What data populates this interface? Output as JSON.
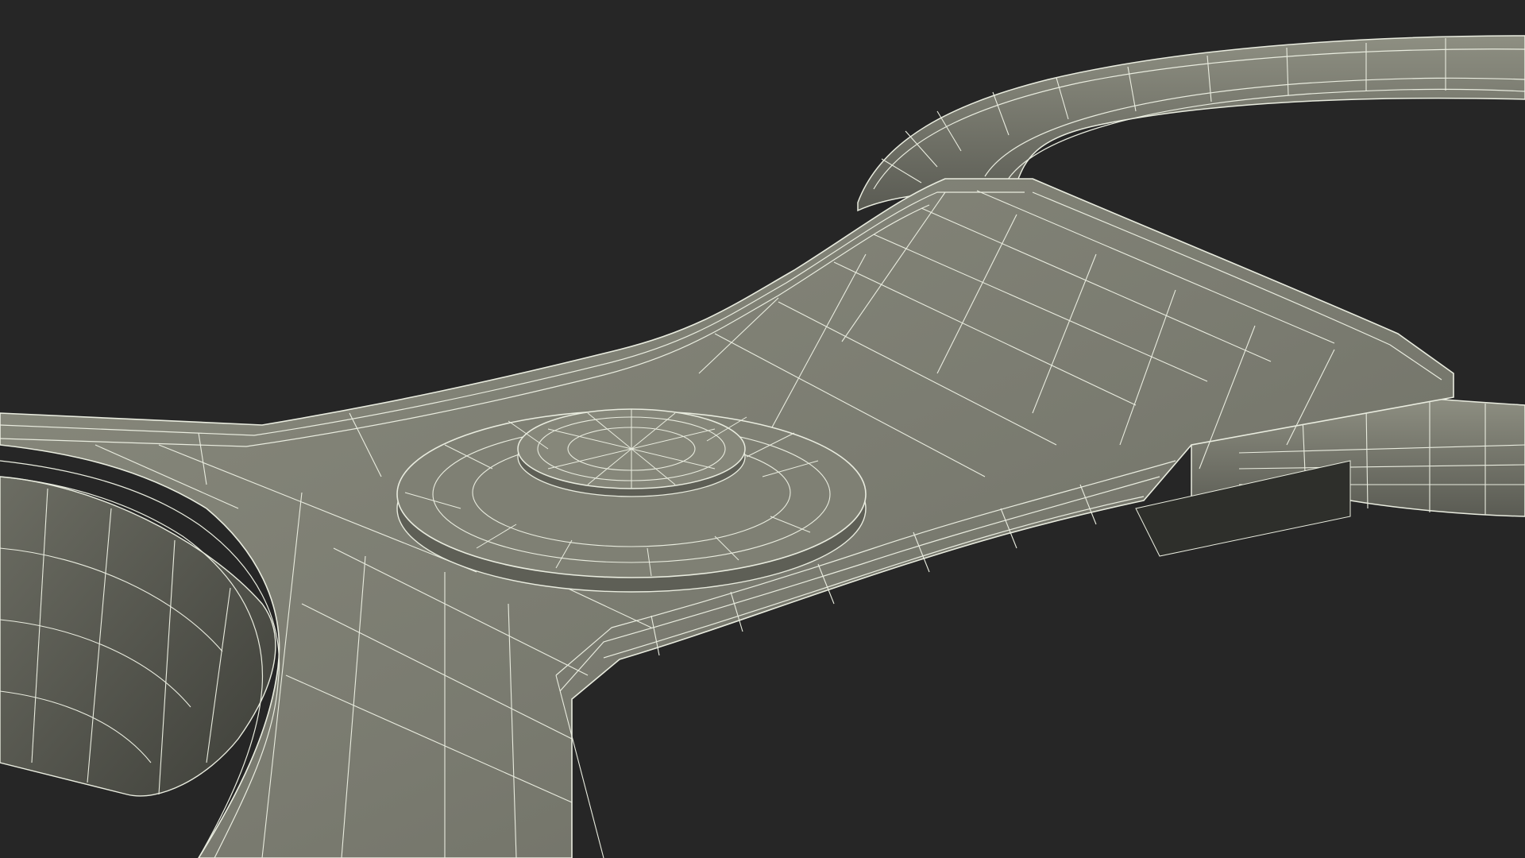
{
  "scene": {
    "colors": {
      "background": "#262626",
      "surface": "#7a7b70",
      "surface_light": "#858679",
      "surface_dark": "#5e5f56",
      "shadow": "#4a4b44",
      "wire": "#e9ecdf"
    }
  }
}
